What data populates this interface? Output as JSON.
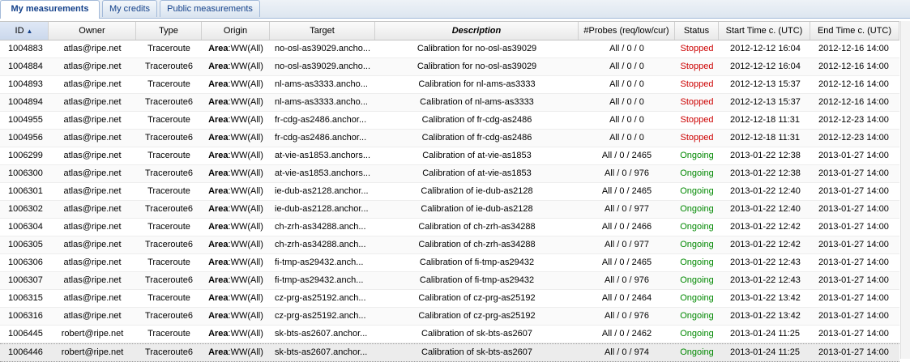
{
  "tabs": [
    "My measurements",
    "My credits",
    "Public measurements"
  ],
  "columns": {
    "id": "ID",
    "owner": "Owner",
    "type": "Type",
    "origin": "Origin",
    "target": "Target",
    "description": "Description",
    "probes": "#Probes (req/low/cur)",
    "status": "Status",
    "start": "Start Time c. (UTC)",
    "end": "End Time c. (UTC)"
  },
  "origin_bold": "Area",
  "origin_rest": ":WW(All)",
  "colors": {
    "stopped": "#cc0000",
    "ongoing": "#008800",
    "tab_text": "#15428b"
  },
  "rows": [
    {
      "id": "1004883",
      "owner": "atlas@ripe.net",
      "type": "Traceroute",
      "target": "no-osl-as39029.ancho...",
      "description": "Calibration for no-osl-as39029",
      "probes": "All / 0 / 0",
      "status": "Stopped",
      "start": "2012-12-12 16:04",
      "end": "2012-12-16 14:00"
    },
    {
      "id": "1004884",
      "owner": "atlas@ripe.net",
      "type": "Traceroute6",
      "target": "no-osl-as39029.ancho...",
      "description": "Calibration for no-osl-as39029",
      "probes": "All / 0 / 0",
      "status": "Stopped",
      "start": "2012-12-12 16:04",
      "end": "2012-12-16 14:00"
    },
    {
      "id": "1004893",
      "owner": "atlas@ripe.net",
      "type": "Traceroute",
      "target": "nl-ams-as3333.ancho...",
      "description": "Calibration for nl-ams-as3333",
      "probes": "All / 0 / 0",
      "status": "Stopped",
      "start": "2012-12-13 15:37",
      "end": "2012-12-16 14:00"
    },
    {
      "id": "1004894",
      "owner": "atlas@ripe.net",
      "type": "Traceroute6",
      "target": "nl-ams-as3333.ancho...",
      "description": "Calibration of nl-ams-as3333",
      "probes": "All / 0 / 0",
      "status": "Stopped",
      "start": "2012-12-13 15:37",
      "end": "2012-12-16 14:00"
    },
    {
      "id": "1004955",
      "owner": "atlas@ripe.net",
      "type": "Traceroute",
      "target": "fr-cdg-as2486.anchor...",
      "description": "Calibration of fr-cdg-as2486",
      "probes": "All / 0 / 0",
      "status": "Stopped",
      "start": "2012-12-18 11:31",
      "end": "2012-12-23 14:00"
    },
    {
      "id": "1004956",
      "owner": "atlas@ripe.net",
      "type": "Traceroute6",
      "target": "fr-cdg-as2486.anchor...",
      "description": "Calibration of fr-cdg-as2486",
      "probes": "All / 0 / 0",
      "status": "Stopped",
      "start": "2012-12-18 11:31",
      "end": "2012-12-23 14:00"
    },
    {
      "id": "1006299",
      "owner": "atlas@ripe.net",
      "type": "Traceroute",
      "target": "at-vie-as1853.anchors...",
      "description": "Calibration of at-vie-as1853",
      "probes": "All / 0 / 2465",
      "status": "Ongoing",
      "start": "2013-01-22 12:38",
      "end": "2013-01-27 14:00"
    },
    {
      "id": "1006300",
      "owner": "atlas@ripe.net",
      "type": "Traceroute6",
      "target": "at-vie-as1853.anchors...",
      "description": "Calibration of at-vie-as1853",
      "probes": "All / 0 / 976",
      "status": "Ongoing",
      "start": "2013-01-22 12:38",
      "end": "2013-01-27 14:00"
    },
    {
      "id": "1006301",
      "owner": "atlas@ripe.net",
      "type": "Traceroute",
      "target": "ie-dub-as2128.anchor...",
      "description": "Calibration of ie-dub-as2128",
      "probes": "All / 0 / 2465",
      "status": "Ongoing",
      "start": "2013-01-22 12:40",
      "end": "2013-01-27 14:00"
    },
    {
      "id": "1006302",
      "owner": "atlas@ripe.net",
      "type": "Traceroute6",
      "target": "ie-dub-as2128.anchor...",
      "description": "Calibration of ie-dub-as2128",
      "probes": "All / 0 / 977",
      "status": "Ongoing",
      "start": "2013-01-22 12:40",
      "end": "2013-01-27 14:00"
    },
    {
      "id": "1006304",
      "owner": "atlas@ripe.net",
      "type": "Traceroute",
      "target": "ch-zrh-as34288.anch...",
      "description": "Calibration of ch-zrh-as34288",
      "probes": "All / 0 / 2466",
      "status": "Ongoing",
      "start": "2013-01-22 12:42",
      "end": "2013-01-27 14:00"
    },
    {
      "id": "1006305",
      "owner": "atlas@ripe.net",
      "type": "Traceroute6",
      "target": "ch-zrh-as34288.anch...",
      "description": "Calibration of ch-zrh-as34288",
      "probes": "All / 0 / 977",
      "status": "Ongoing",
      "start": "2013-01-22 12:42",
      "end": "2013-01-27 14:00"
    },
    {
      "id": "1006306",
      "owner": "atlas@ripe.net",
      "type": "Traceroute",
      "target": "fi-tmp-as29432.anch...",
      "description": "Calibration of fi-tmp-as29432",
      "probes": "All / 0 / 2465",
      "status": "Ongoing",
      "start": "2013-01-22 12:43",
      "end": "2013-01-27 14:00"
    },
    {
      "id": "1006307",
      "owner": "atlas@ripe.net",
      "type": "Traceroute6",
      "target": "fi-tmp-as29432.anch...",
      "description": "Calibration of fi-tmp-as29432",
      "probes": "All / 0 / 976",
      "status": "Ongoing",
      "start": "2013-01-22 12:43",
      "end": "2013-01-27 14:00"
    },
    {
      "id": "1006315",
      "owner": "atlas@ripe.net",
      "type": "Traceroute",
      "target": "cz-prg-as25192.anch...",
      "description": "Calibration of cz-prg-as25192",
      "probes": "All / 0 / 2464",
      "status": "Ongoing",
      "start": "2013-01-22 13:42",
      "end": "2013-01-27 14:00"
    },
    {
      "id": "1006316",
      "owner": "atlas@ripe.net",
      "type": "Traceroute6",
      "target": "cz-prg-as25192.anch...",
      "description": "Calibration of cz-prg-as25192",
      "probes": "All / 0 / 976",
      "status": "Ongoing",
      "start": "2013-01-22 13:42",
      "end": "2013-01-27 14:00"
    },
    {
      "id": "1006445",
      "owner": "robert@ripe.net",
      "type": "Traceroute",
      "target": "sk-bts-as2607.anchor...",
      "description": "Calibration of sk-bts-as2607",
      "probes": "All / 0 / 2462",
      "status": "Ongoing",
      "start": "2013-01-24 11:25",
      "end": "2013-01-27 14:00"
    },
    {
      "id": "1006446",
      "owner": "robert@ripe.net",
      "type": "Traceroute6",
      "target": "sk-bts-as2607.anchor...",
      "description": "Calibration of sk-bts-as2607",
      "probes": "All / 0 / 974",
      "status": "Ongoing",
      "start": "2013-01-24 11:25",
      "end": "2013-01-27 14:00"
    }
  ]
}
